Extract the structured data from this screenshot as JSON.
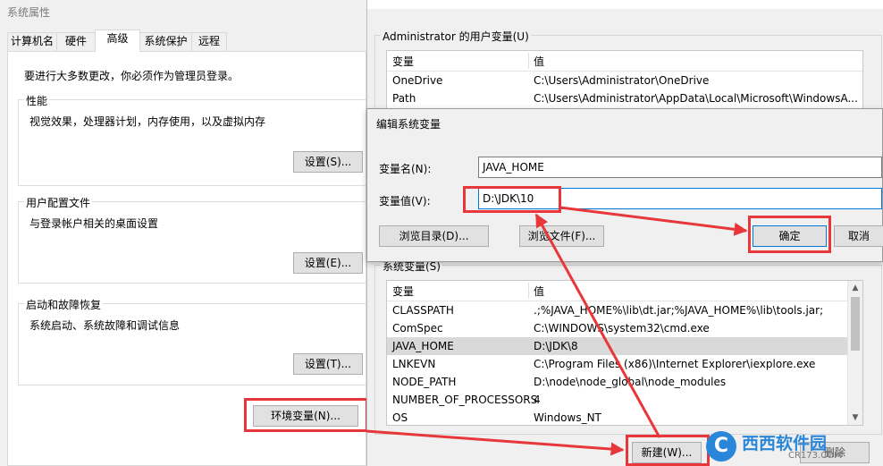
{
  "sysprops": {
    "title": "系统属性",
    "tabs": [
      "计算机名",
      "硬件",
      "高级",
      "系统保护",
      "远程"
    ],
    "admin_note": "要进行大多数更改，你必须作为管理员登录。",
    "performance": {
      "title": "性能",
      "desc": "视觉效果，处理器计划，内存使用，以及虚拟内存",
      "button": "设置(S)..."
    },
    "profile": {
      "title": "用户配置文件",
      "desc": "与登录帐户相关的桌面设置",
      "button": "设置(E)..."
    },
    "startup": {
      "title": "启动和故障恢复",
      "desc": "系统启动、系统故障和调试信息",
      "button": "设置(T)..."
    },
    "env_button": "环境变量(N)..."
  },
  "envvars": {
    "user_group_title": "Administrator 的用户变量(U)",
    "col_name": "变量",
    "col_value": "值",
    "user_vars": [
      {
        "name": "OneDrive",
        "value": "C:\\Users\\Administrator\\OneDrive"
      },
      {
        "name": "Path",
        "value": "C:\\Users\\Administrator\\AppData\\Local\\Microsoft\\WindowsA..."
      }
    ],
    "sys_group_title": "系统变量(S)",
    "sys_vars": [
      {
        "name": "CLASSPATH",
        "value": ".;%JAVA_HOME%\\lib\\dt.jar;%JAVA_HOME%\\lib\\tools.jar;"
      },
      {
        "name": "ComSpec",
        "value": "C:\\WINDOWS\\system32\\cmd.exe"
      },
      {
        "name": "JAVA_HOME",
        "value": "D:\\JDK\\8"
      },
      {
        "name": "LNKEVN",
        "value": "C:\\Program Files (x86)\\Internet Explorer\\iexplore.exe"
      },
      {
        "name": "NODE_PATH",
        "value": "D:\\node\\node_global\\node_modules"
      },
      {
        "name": "NUMBER_OF_PROCESSORS",
        "value": "4"
      },
      {
        "name": "OS",
        "value": "Windows_NT"
      }
    ],
    "new_button": "新建(W)...",
    "delete_button": "删除"
  },
  "editdlg": {
    "title": "编辑系统变量",
    "name_label": "变量名(N):",
    "name_value": "JAVA_HOME",
    "value_label": "变量值(V):",
    "value_value": "D:\\JDK\\10",
    "browse_dir": "浏览目录(D)...",
    "browse_file": "浏览文件(F)...",
    "ok": "确定",
    "cancel": "取消"
  },
  "watermark": {
    "brand": "西西软件园",
    "url": "CR173.COM"
  },
  "colors": {
    "annotation_red": "#e8373a",
    "selection_gray": "#d9d9d9"
  }
}
